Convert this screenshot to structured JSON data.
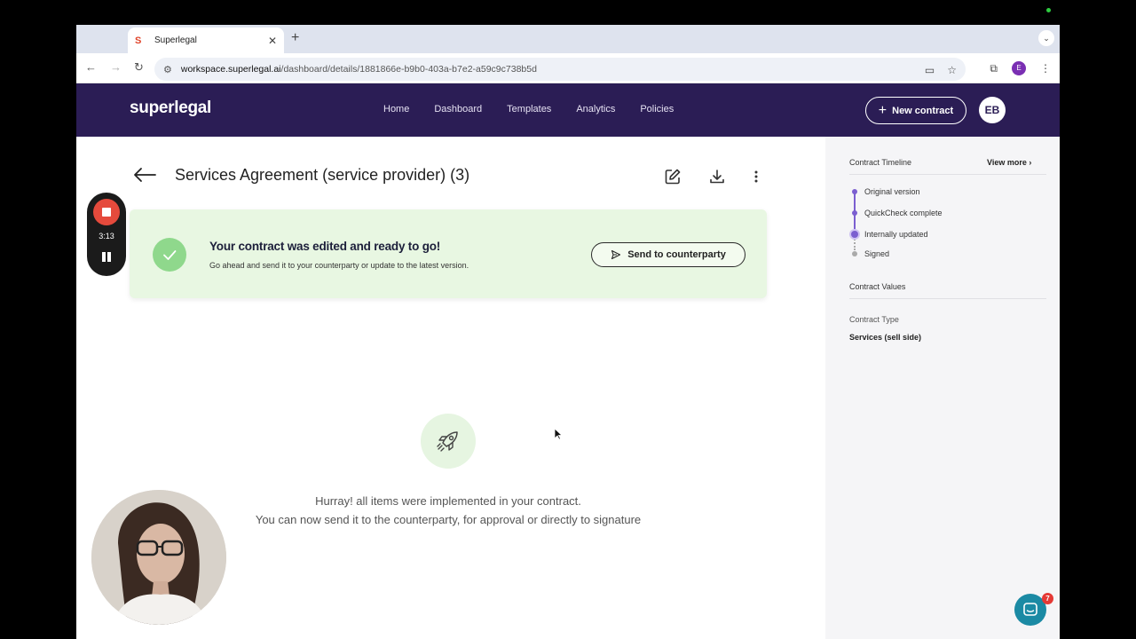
{
  "browser": {
    "tab_title": "Superlegal",
    "tab_favicon": "S",
    "url_host": "workspace.superlegal.ai",
    "url_path": "/dashboard/details/1881866e-b9b0-403a-b7e2-a59c9c738b5d",
    "profile_initial": "E"
  },
  "header": {
    "logo": "superlegal",
    "nav": [
      "Home",
      "Dashboard",
      "Templates",
      "Analytics",
      "Policies"
    ],
    "new_contract": "New contract",
    "avatar": "EB"
  },
  "main": {
    "title": "Services Agreement (service provider) (3)",
    "banner_title": "Your contract was edited and ready to go!",
    "banner_sub": "Go ahead and send it to your counterparty or update to the latest version.",
    "send_button": "Send to counterparty",
    "hurray_line1": "Hurray! all items were implemented in your contract.",
    "hurray_line2": "You can now send it to the counterparty, for approval or directly to signature"
  },
  "sidebar": {
    "timeline_heading": "Contract Timeline",
    "view_more": "View more",
    "timeline": [
      "Original version",
      "QuickCheck complete",
      "Internally updated",
      "Signed"
    ],
    "values_heading": "Contract Values",
    "contract_type_label": "Contract Type",
    "contract_type_value": "Services (sell side)"
  },
  "recorder": {
    "time": "3:13"
  },
  "chat": {
    "badge_count": "7"
  },
  "colors": {
    "header_bg": "#2b1d55",
    "banner_bg": "#e8f7e2",
    "timeline_accent": "#7b5fd0",
    "record_red": "#e54a3c"
  }
}
